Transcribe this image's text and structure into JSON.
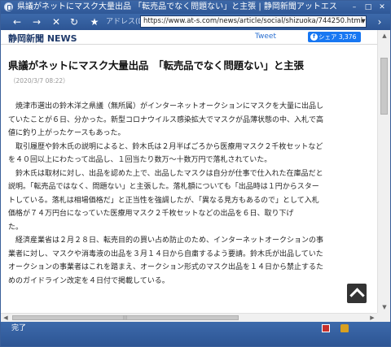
{
  "window": {
    "title": "県議がネットにマスク大量出品 「転売品でなく問題ない」と主張 | 静岡新聞アットエス",
    "minimize": "–",
    "maximize": "□",
    "close": "✕"
  },
  "navbar": {
    "back": "←",
    "forward": "→",
    "stop": "✕",
    "reload": "↻",
    "favorite": "★",
    "address_label": "アドレス(D)",
    "url": "https://www.at-s.com/news/article/social/shizuoka/744250.html",
    "go": "›"
  },
  "site": {
    "logo": "静岡新聞 NEWS",
    "tweet": "Tweet",
    "share_label": "シェア 3,376",
    "fb_glyph": "f"
  },
  "article": {
    "headline": "県議がネットにマスク大量出品　「転売品でなく問題ない」と主張",
    "date": "（2020/3/7 08:22）",
    "lines": [
      "　焼津市選出の鈴木洋之県議（無所属）がインターネットオークションにマスクを大量に出品し",
      "ていたことが６日、分かった。新型コロナウイルス感染拡大でマスクが品薄状態の中、入札で高",
      "値に釣り上がったケースもあった。",
      "　取引履歴や鈴木氏の説明によると、鈴木氏は２月半ばごろから医療用マスク２千枚セットなど",
      "を４０回以上にわたって出品し、１回当たり数万～十数万円で落札されていた。",
      "　鈴木氏は取材に対し、出品を認めた上で、出品したマスクは自分が仕事で仕入れた在庫品だと",
      "説明。「転売品ではなく、問題ない」と主張した。落札額についても「出品時は１円からスター",
      "トしている。落札は相場価格だ」と正当性を強調したが、「異なる見方もあるので」として入札",
      "価格が７４万円台になっていた医療用マスク２千枚セットなどの出品を６日、取り下げ",
      "た。",
      "　経済産業省は２月２８日、転売目的の買い占め防止のため、インターネットオークションの事",
      "業者に対し、マスクや消毒液の出品を３月１４日から自粛するよう要請。鈴木氏が出品していた",
      "オークションの事業者はこれを踏まえ、オークション形式のマスク出品を１４日から禁止するた",
      "めのガイドライン改定を４日付で掲載している。"
    ]
  },
  "scrollbars": {
    "up": "▲",
    "down": "▼",
    "left": "◀",
    "right": "▶",
    "grip": "|||"
  },
  "status": {
    "text": "完了"
  }
}
